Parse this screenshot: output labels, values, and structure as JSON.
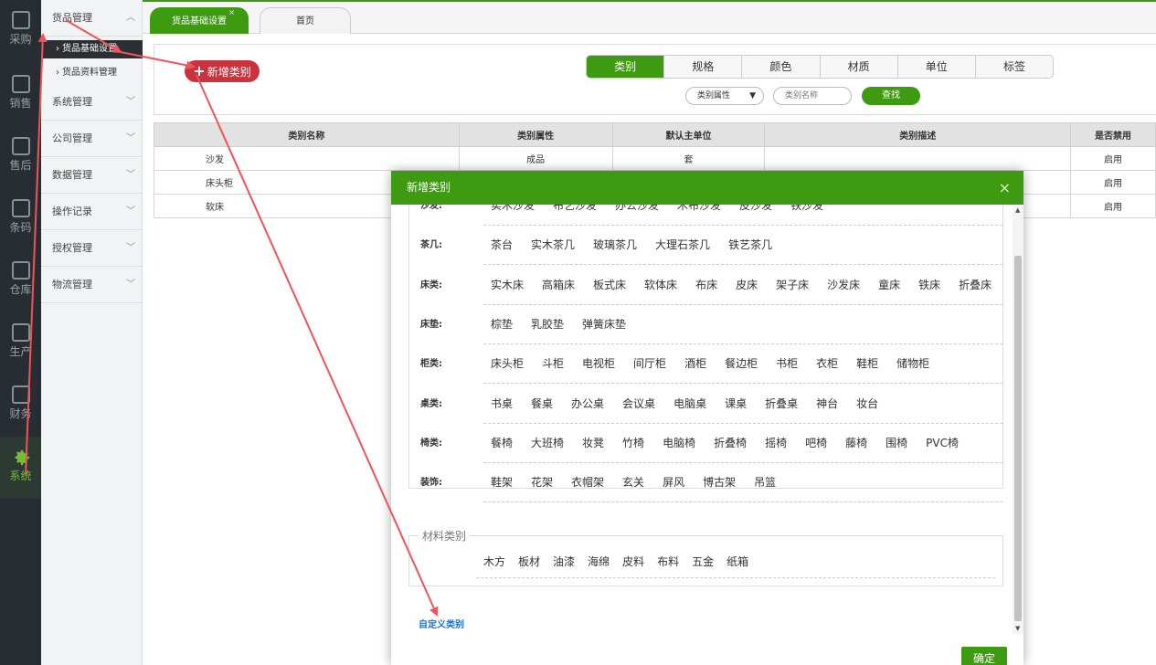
{
  "rail": [
    {
      "label": "采购",
      "icon": "cart-icon"
    },
    {
      "label": "销售",
      "icon": "grid-icon"
    },
    {
      "label": "售后",
      "icon": "grid-icon"
    },
    {
      "label": "条码",
      "icon": "barcode-icon"
    },
    {
      "label": "仓库",
      "icon": "warehouse-icon"
    },
    {
      "label": "生产",
      "icon": "production-icon"
    },
    {
      "label": "财务",
      "icon": "calculator-icon"
    },
    {
      "label": "系统",
      "icon": "gear-icon"
    }
  ],
  "submenu": {
    "goods": "货品管理",
    "goods_base": "货品基础设置",
    "goods_info": "货品资料管理",
    "system": "系统管理",
    "company": "公司管理",
    "data": "数据管理",
    "oplog": "操作记录",
    "auth": "授权管理",
    "logistics": "物流管理"
  },
  "tabs": {
    "active": "货品基础设置",
    "home": "首页",
    "close": "×"
  },
  "toolbar": {
    "add_label": "新增类别",
    "segments": [
      "类别",
      "规格",
      "颜色",
      "材质",
      "单位",
      "标签"
    ],
    "attr_select": "类别属性",
    "search_placeholder": "类别名称",
    "find_label": "查找"
  },
  "table": {
    "headers": [
      "类别名称",
      "类别属性",
      "默认主单位",
      "类别描述",
      "是否禁用"
    ],
    "rows": [
      [
        "沙发",
        "成品",
        "套",
        "",
        "启用"
      ],
      [
        "床头柜",
        "",
        "",
        "",
        "启用"
      ],
      [
        "软床",
        "",
        "",
        "",
        "启用"
      ]
    ]
  },
  "modal": {
    "title": "新增类别",
    "close": "×",
    "categories": [
      {
        "label": "沙发:",
        "items": [
          "实木沙发",
          "布艺沙发",
          "办公沙发",
          "木布沙发",
          "皮沙发",
          "铁沙发"
        ]
      },
      {
        "label": "茶几:",
        "items": [
          "茶台",
          "实木茶几",
          "玻璃茶几",
          "大理石茶几",
          "铁艺茶几"
        ]
      },
      {
        "label": "床类:",
        "items": [
          "实木床",
          "高箱床",
          "板式床",
          "软体床",
          "布床",
          "皮床",
          "架子床",
          "沙发床",
          "童床",
          "铁床",
          "折叠床"
        ]
      },
      {
        "label": "床垫:",
        "items": [
          "棕垫",
          "乳胶垫",
          "弹簧床垫"
        ]
      },
      {
        "label": "柜类:",
        "items": [
          "床头柜",
          "斗柜",
          "电视柜",
          "间厅柜",
          "酒柜",
          "餐边柜",
          "书柜",
          "衣柜",
          "鞋柜",
          "储物柜"
        ]
      },
      {
        "label": "桌类:",
        "items": [
          "书桌",
          "餐桌",
          "办公桌",
          "会议桌",
          "电脑桌",
          "课桌",
          "折叠桌",
          "神台",
          "妆台"
        ]
      },
      {
        "label": "椅类:",
        "items": [
          "餐椅",
          "大班椅",
          "妆凳",
          "竹椅",
          "电脑椅",
          "折叠椅",
          "摇椅",
          "吧椅",
          "藤椅",
          "围椅",
          "PVC椅"
        ]
      },
      {
        "label": "装饰:",
        "items": [
          "鞋架",
          "花架",
          "衣帽架",
          "玄关",
          "屏风",
          "博古架",
          "吊篮"
        ]
      }
    ],
    "material_legend": "材料类别",
    "materials": [
      "木方",
      "板材",
      "油漆",
      "海绵",
      "皮料",
      "布料",
      "五金",
      "纸箱"
    ],
    "custom_link": "自定义类别",
    "confirm": "确定"
  },
  "colors": {
    "green": "#3e9a11",
    "red_button": "#c9333e",
    "annotation_arrow": "#f0545a"
  }
}
